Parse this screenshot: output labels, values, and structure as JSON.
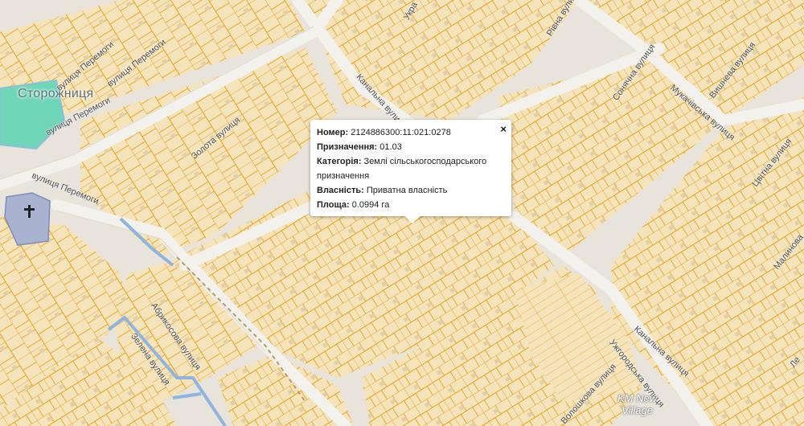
{
  "map": {
    "district_label": "Сторожниця",
    "village_label_line1": "KM New",
    "village_label_line2": "Village",
    "church_icon": "cross-icon",
    "streets": [
      {
        "name": "вулиця Перемоги",
        "key": "peremohy_1"
      },
      {
        "name": "вулиця Перемоги",
        "key": "peremohy_2"
      },
      {
        "name": "вулиця Перемоги",
        "key": "peremohy_3"
      },
      {
        "name": "вулиця Перемоги",
        "key": "peremohy_4"
      },
      {
        "name": "Золота вулиця",
        "key": "zolota"
      },
      {
        "name": "Канальна вулиця",
        "key": "kanalna_1"
      },
      {
        "name": "Канальна вулиця",
        "key": "kanalna_2"
      },
      {
        "name": "Рівна вулиця",
        "key": "rivna"
      },
      {
        "name": "Сонячна вулиця",
        "key": "soniachna"
      },
      {
        "name": "Вишнева вулиця",
        "key": "vyshneva"
      },
      {
        "name": "Мукачівська вулиця",
        "key": "mukachivska"
      },
      {
        "name": "Цвітна вулиця",
        "key": "tsvitna"
      },
      {
        "name": "Малинова",
        "key": "malynova"
      },
      {
        "name": "Абрикосова вулиця",
        "key": "abrykosova"
      },
      {
        "name": "Зелена вулиця",
        "key": "zelena"
      },
      {
        "name": "Ужгородська вулиця",
        "key": "uzhhorodska"
      },
      {
        "name": "Волошкова вулиця",
        "key": "voloshkova"
      },
      {
        "name": "Укра",
        "key": "ukra"
      },
      {
        "name": "Ле",
        "key": "le"
      }
    ],
    "colors": {
      "background": "#e8e4dc",
      "parcel_fill": "#f5e3bb",
      "parcel_stroke": "#e8a21c",
      "road": "#f3f1ec",
      "water_fill": "#70d6b8",
      "canal": "#8fb4dd",
      "church_fill": "#a9b3cf"
    }
  },
  "popup": {
    "number_label": "Номер:",
    "number_value": "2124886300:11:021:0278",
    "purpose_label": "Призначення:",
    "purpose_value": "01.03",
    "category_label": "Категорія:",
    "category_value_line1": "Землі сільськогосподарського",
    "category_value_line2": "призначення",
    "ownership_label": "Власність:",
    "ownership_value": "Приватна власність",
    "area_label": "Площа:",
    "area_value": "0.0994 га",
    "close_symbol": "×"
  }
}
